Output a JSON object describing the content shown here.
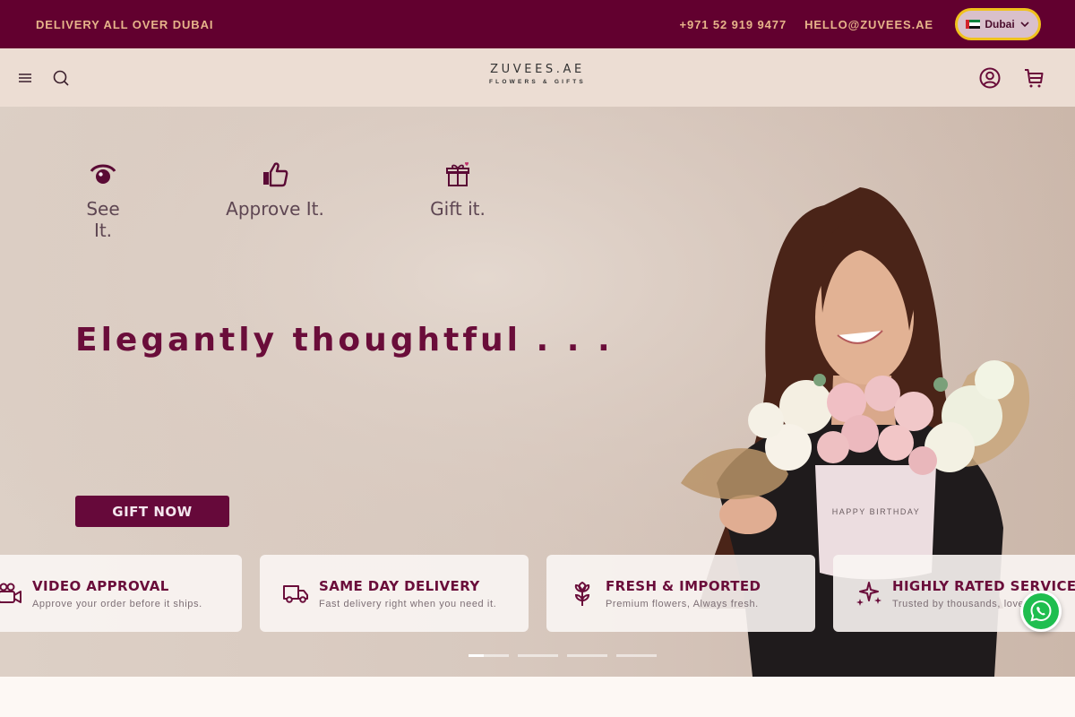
{
  "announcement": {
    "promo": "DELIVERY ALL OVER DUBAI",
    "phone": "+971 52 919 9477",
    "email": "HELLO@ZUVEES.AE",
    "region": {
      "label": "Dubai",
      "flag_icon": "uae-flag-icon",
      "chevron_icon": "chevron-down-icon"
    }
  },
  "header": {
    "menu_icon": "menu-icon",
    "search_icon": "search-icon",
    "logo": {
      "name": "ZUVEES.AE",
      "tagline": "FLOWERS & GIFTS"
    },
    "account_icon": "user-icon",
    "cart_icon": "cart-icon"
  },
  "hero": {
    "steps": [
      {
        "icon": "eye-icon",
        "label": "See It."
      },
      {
        "icon": "thumbs-up-icon",
        "label": "Approve It."
      },
      {
        "icon": "gift-icon",
        "label": "Gift it."
      }
    ],
    "headline": "Elegantly thoughtful . . .",
    "cta": "GIFT NOW",
    "box_text": "HAPPY BIRTHDAY",
    "features": [
      {
        "icon": "video-camera-icon",
        "title": "VIDEO APPROVAL",
        "subtitle": "Approve your order before it ships."
      },
      {
        "icon": "delivery-truck-icon",
        "title": "SAME DAY DELIVERY",
        "subtitle": "Fast delivery right when you need it."
      },
      {
        "icon": "flower-icon",
        "title": "FRESH & IMPORTED",
        "subtitle": "Premium flowers, Always fresh."
      },
      {
        "icon": "sparkles-icon",
        "title": "HIGHLY RATED SERVICE",
        "subtitle": "Trusted by thousands, loved"
      }
    ],
    "slides": {
      "count": 4,
      "active": 1,
      "progress": 0.38
    }
  },
  "chat": {
    "icon": "whatsapp-icon"
  },
  "colors": {
    "brand": "#62002f",
    "accent_text": "#e6b48a",
    "header_bg": "#ecddd3",
    "cta_bg": "#66093a",
    "highlight": "#f0c21d"
  }
}
